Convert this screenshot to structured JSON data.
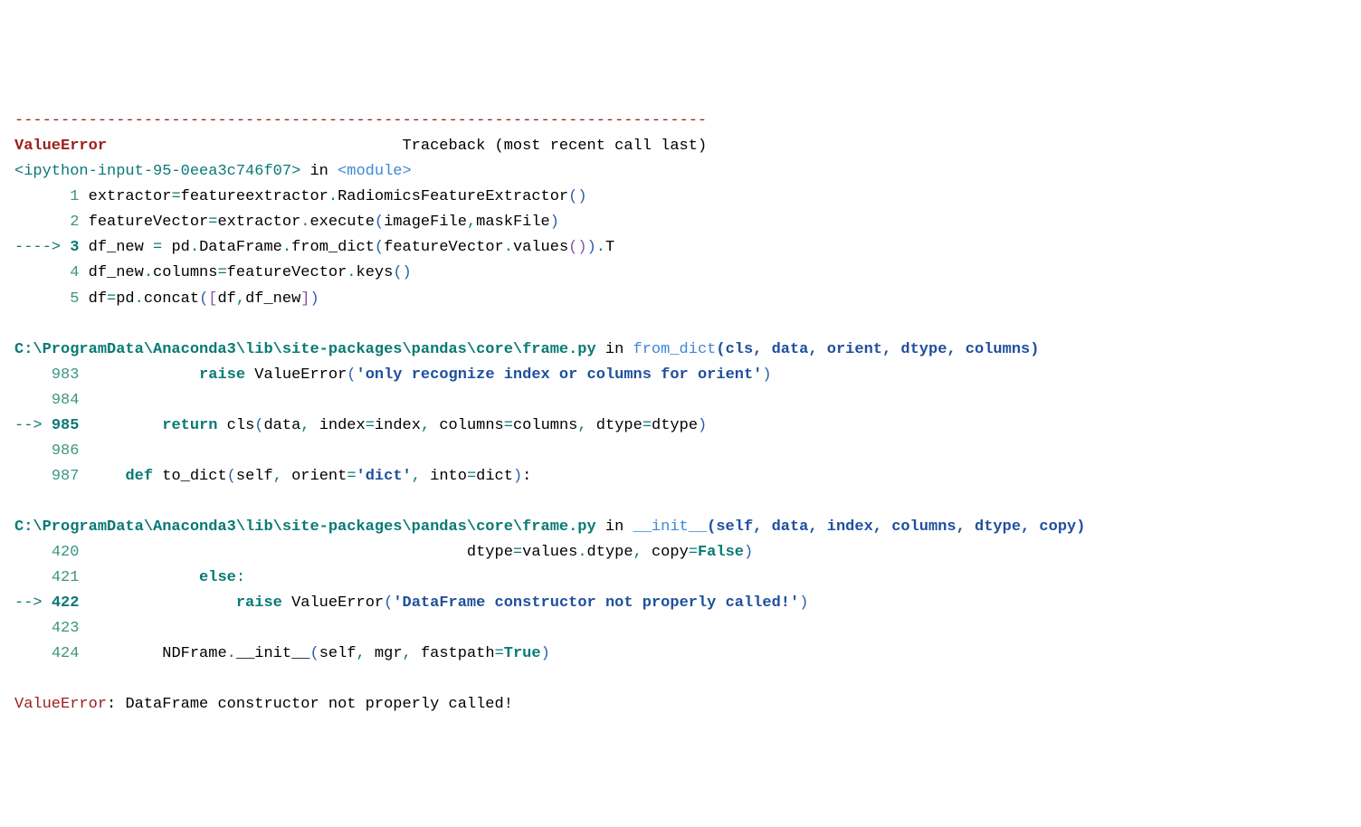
{
  "separator": "---------------------------------------------------------------------------",
  "header": {
    "error_name": "ValueError",
    "spacer": "                                ",
    "traceback_label": "Traceback (most recent call last)"
  },
  "frame1": {
    "ipython_open": "<",
    "ipython_text": "ipython-input-95-0eea3c746f07",
    "ipython_close": ">",
    "in_text": " in ",
    "module_open": "<",
    "module_text": "module",
    "module_close": ">",
    "line1": {
      "prefix": "      ",
      "num": "1",
      "sp": " ",
      "t1": "extractor",
      "eq": "=",
      "t2": "featureextractor",
      "dot": ".",
      "t3": "RadiomicsFeatureExtractor",
      "po": "(",
      "pc": ")"
    },
    "line2": {
      "prefix": "      ",
      "num": "2",
      "sp": " ",
      "t1": "featureVector",
      "eq": "=",
      "t2": "extractor",
      "dot": ".",
      "t3": "execute",
      "po": "(",
      "a1": "imageFile",
      "comma": ",",
      "a2": "maskFile",
      "pc": ")"
    },
    "line3": {
      "arrow": "----> ",
      "num": "3",
      "sp": " ",
      "t1": "df_new ",
      "eq": "=",
      "t2": " pd",
      "dot1": ".",
      "t3": "DataFrame",
      "dot2": ".",
      "t4": "from_dict",
      "po1": "(",
      "t5": "featureVector",
      "dot3": ".",
      "t6": "values",
      "po2": "(",
      "pc2": ")",
      "pc1": ")",
      "dot4": ".",
      "t7": "T"
    },
    "line4": {
      "prefix": "      ",
      "num": "4",
      "sp": " ",
      "t1": "df_new",
      "dot1": ".",
      "t2": "columns",
      "eq": "=",
      "t3": "featureVector",
      "dot2": ".",
      "t4": "keys",
      "po": "(",
      "pc": ")"
    },
    "line5": {
      "prefix": "      ",
      "num": "5",
      "sp": " ",
      "t1": "df",
      "eq": "=",
      "t2": "pd",
      "dot": ".",
      "t3": "concat",
      "po": "(",
      "bo": "[",
      "a1": "df",
      "comma": ",",
      "a2": "df_new",
      "bc": "]",
      "pc": ")"
    }
  },
  "frame2": {
    "path": "C:\\ProgramData\\Anaconda3\\lib\\site-packages\\pandas\\core\\frame.py",
    "in_text": " in ",
    "method": "from_dict",
    "po": "(",
    "params": "cls, data, orient, dtype, columns",
    "pc": ")",
    "line983": {
      "prefix": "    ",
      "num": "983",
      "sp": "             ",
      "kw": "raise",
      "sp2": " ",
      "t1": "ValueError",
      "po": "(",
      "str": "'only recognize index or columns for orient'",
      "pc": ")"
    },
    "line984": {
      "prefix": "    ",
      "num": "984"
    },
    "line985": {
      "arrow": "--> ",
      "num": "985",
      "sp": "         ",
      "kw": "return",
      "sp2": " ",
      "t1": "cls",
      "po": "(",
      "a1": "data",
      "c1": ",",
      "sp3": " ",
      "a2": "index",
      "eq1": "=",
      "a2v": "index",
      "c2": ",",
      "sp4": " ",
      "a3": "columns",
      "eq2": "=",
      "a3v": "columns",
      "c3": ",",
      "sp5": " ",
      "a4": "dtype",
      "eq3": "=",
      "a4v": "dtype",
      "pc": ")"
    },
    "line986": {
      "prefix": "    ",
      "num": "986"
    },
    "line987": {
      "prefix": "    ",
      "num": "987",
      "sp": "     ",
      "kw": "def",
      "sp2": " ",
      "t1": "to_dict",
      "po": "(",
      "a1": "self",
      "c1": ",",
      "sp3": " ",
      "a2": "orient",
      "eq1": "=",
      "str": "'dict'",
      "c2": ",",
      "sp4": " ",
      "a3": "into",
      "eq2": "=",
      "a3v": "dict",
      "pc": ")",
      "colon": ":"
    }
  },
  "frame3": {
    "path": "C:\\ProgramData\\Anaconda3\\lib\\site-packages\\pandas\\core\\frame.py",
    "in_text": " in ",
    "method": "__init__",
    "po": "(",
    "params": "self, data, index, columns, dtype, copy",
    "pc": ")",
    "line420": {
      "prefix": "    ",
      "num": "420",
      "sp": "                                          ",
      "a1": "dtype",
      "eq1": "=",
      "t1": "values",
      "dot": ".",
      "t2": "dtype",
      "c1": ",",
      "sp2": " ",
      "a2": "copy",
      "eq2": "=",
      "val": "False",
      "pc": ")"
    },
    "line421": {
      "prefix": "    ",
      "num": "421",
      "sp": "             ",
      "kw": "else",
      "colon": ":"
    },
    "line422": {
      "arrow": "--> ",
      "num": "422",
      "sp": "                 ",
      "kw": "raise",
      "sp2": " ",
      "t1": "ValueError",
      "po": "(",
      "str": "'DataFrame constructor not properly called!'",
      "pc": ")"
    },
    "line423": {
      "prefix": "    ",
      "num": "423"
    },
    "line424": {
      "prefix": "    ",
      "num": "424",
      "sp": "         ",
      "t1": "NDFrame",
      "dot": ".",
      "t2": "__init__",
      "po": "(",
      "a1": "self",
      "c1": ",",
      "sp2": " ",
      "a2": "mgr",
      "c2": ",",
      "sp3": " ",
      "a3": "fastpath",
      "eq": "=",
      "val": "True",
      "pc": ")"
    }
  },
  "final": {
    "error_name": "ValueError",
    "colon": ": ",
    "message": "DataFrame constructor not properly called!"
  }
}
